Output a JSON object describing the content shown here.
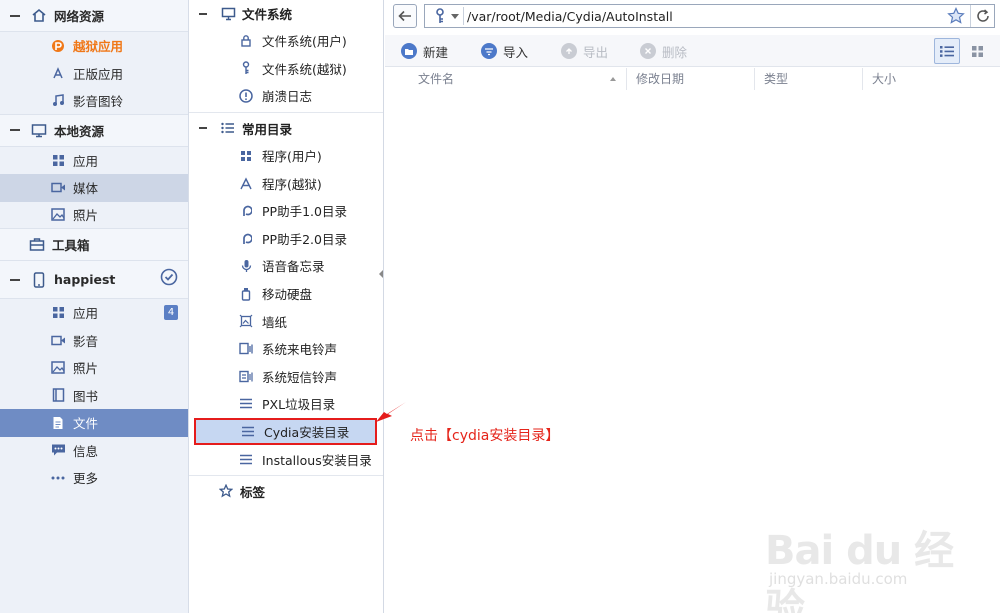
{
  "left_nav": {
    "network": {
      "title": "网络资源",
      "items": [
        {
          "label": "越狱应用",
          "icon": "pp-icon"
        },
        {
          "label": "正版应用",
          "icon": "app-store-icon"
        },
        {
          "label": "影音图铃",
          "icon": "music-note-icon"
        }
      ]
    },
    "local": {
      "title": "本地资源",
      "items": [
        {
          "label": "应用",
          "icon": "grid-icon"
        },
        {
          "label": "媒体",
          "icon": "video-icon"
        },
        {
          "label": "照片",
          "icon": "photo-icon"
        }
      ]
    },
    "toolbox": {
      "title": "工具箱"
    },
    "device": {
      "title": "happiest",
      "items": [
        {
          "label": "应用",
          "icon": "grid-icon",
          "badge": "4"
        },
        {
          "label": "影音",
          "icon": "video-icon"
        },
        {
          "label": "照片",
          "icon": "photo-icon"
        },
        {
          "label": "图书",
          "icon": "book-icon"
        },
        {
          "label": "文件",
          "icon": "file-icon"
        },
        {
          "label": "信息",
          "icon": "message-icon"
        },
        {
          "label": "更多",
          "icon": "more-icon"
        }
      ]
    }
  },
  "tree": {
    "filesystem": {
      "title": "文件系统",
      "items": [
        {
          "label": "文件系统(用户)",
          "icon": "lock-icon"
        },
        {
          "label": "文件系统(越狱)",
          "icon": "key-icon"
        },
        {
          "label": "崩溃日志",
          "icon": "alert-icon"
        }
      ]
    },
    "common": {
      "title": "常用目录",
      "items": [
        {
          "label": "程序(用户)",
          "icon": "grid-icon"
        },
        {
          "label": "程序(越狱)",
          "icon": "app-store-icon"
        },
        {
          "label": "PP助手1.0目录",
          "icon": "pp-icon"
        },
        {
          "label": "PP助手2.0目录",
          "icon": "pp-icon"
        },
        {
          "label": "语音备忘录",
          "icon": "microphone-icon"
        },
        {
          "label": "移动硬盘",
          "icon": "usb-drive-icon"
        },
        {
          "label": "墙纸",
          "icon": "wallpaper-icon"
        },
        {
          "label": "系统来电铃声",
          "icon": "ringtone-icon"
        },
        {
          "label": "系统短信铃声",
          "icon": "sms-tone-icon"
        },
        {
          "label": "PXL垃圾目录",
          "icon": "list-icon"
        },
        {
          "label": "Cydia安装目录",
          "icon": "list-icon"
        },
        {
          "label": "Installous安装目录",
          "icon": "list-icon"
        }
      ]
    },
    "tags": {
      "title": "标签"
    }
  },
  "address_bar": {
    "path": "/var/root/Media/Cydia/AutoInstall"
  },
  "toolbar": {
    "new_label": "新建",
    "import_label": "导入",
    "export_label": "导出",
    "delete_label": "删除"
  },
  "columns": [
    "文件名",
    "修改日期",
    "类型",
    "大小"
  ],
  "annotation": {
    "text": "点击【cydia安装目录】"
  },
  "watermark": {
    "logo": "Bai du 经验",
    "url": "jingyan.baidu.com"
  },
  "colors": {
    "accent": "#6f8cc4",
    "highlight": "#cdd6e6",
    "annotation_red": "#e51c1c",
    "orange": "#f07818"
  }
}
